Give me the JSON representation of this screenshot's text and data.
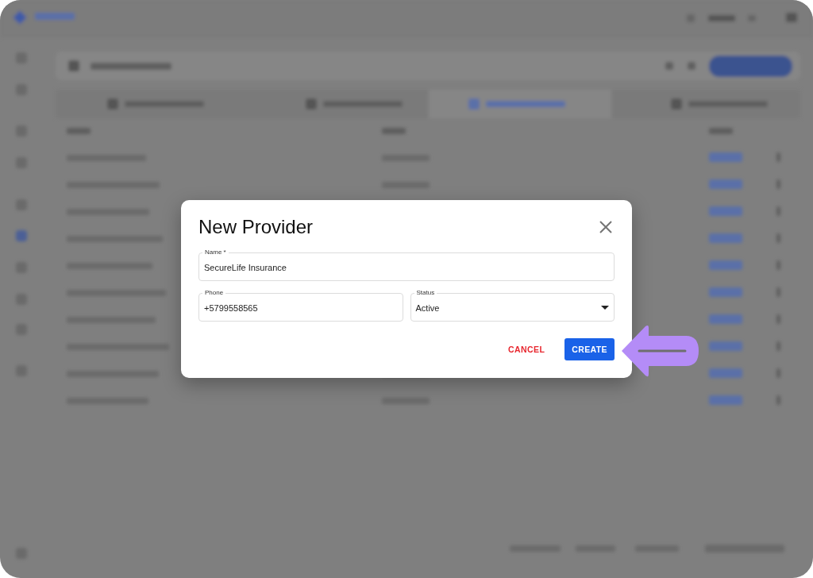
{
  "dialog": {
    "title": "New Provider",
    "fields": [
      {
        "kind": "text",
        "label": "Name *",
        "value": "SecureLife Insurance"
      },
      {
        "kind": "text",
        "label": "Phone",
        "value": "+5799558565"
      },
      {
        "kind": "select",
        "label": "Status",
        "value": "Active"
      }
    ],
    "buttons": [
      {
        "kind": "text",
        "label": "CANCEL"
      },
      {
        "kind": "contained",
        "label": "CREATE"
      }
    ]
  }
}
